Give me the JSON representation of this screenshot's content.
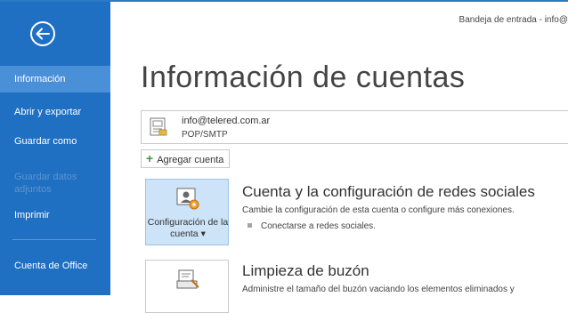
{
  "window": {
    "title": "Bandeja de entrada - info@"
  },
  "sidebar": {
    "items": [
      {
        "label": "Información"
      },
      {
        "label": "Abrir y exportar"
      },
      {
        "label": "Guardar como"
      },
      {
        "label": "Guardar datos adjuntos"
      },
      {
        "label": "Imprimir"
      },
      {
        "label": "Cuenta de Office"
      }
    ]
  },
  "main": {
    "title": "Información de cuentas",
    "account": {
      "email": "info@telered.com.ar",
      "type": "POP/SMTP"
    },
    "add_account_label": "Agregar cuenta",
    "sections": [
      {
        "tile_label": "Configuración de la cuenta",
        "tile_dropdown": "▾",
        "title": "Cuenta y la configuración de redes sociales",
        "description": "Cambie la configuración de esta cuenta o configure más conexiones.",
        "bullet": "Conectarse a redes sociales."
      },
      {
        "tile_label": "",
        "title": "Limpieza de buzón",
        "description": "Administre el tamaño del buzón vaciando los elementos eliminados y"
      }
    ]
  },
  "colors": {
    "sidebar": "#1f6fc2",
    "active": "#4a90d9",
    "selected_tile": "#cde3f7"
  }
}
